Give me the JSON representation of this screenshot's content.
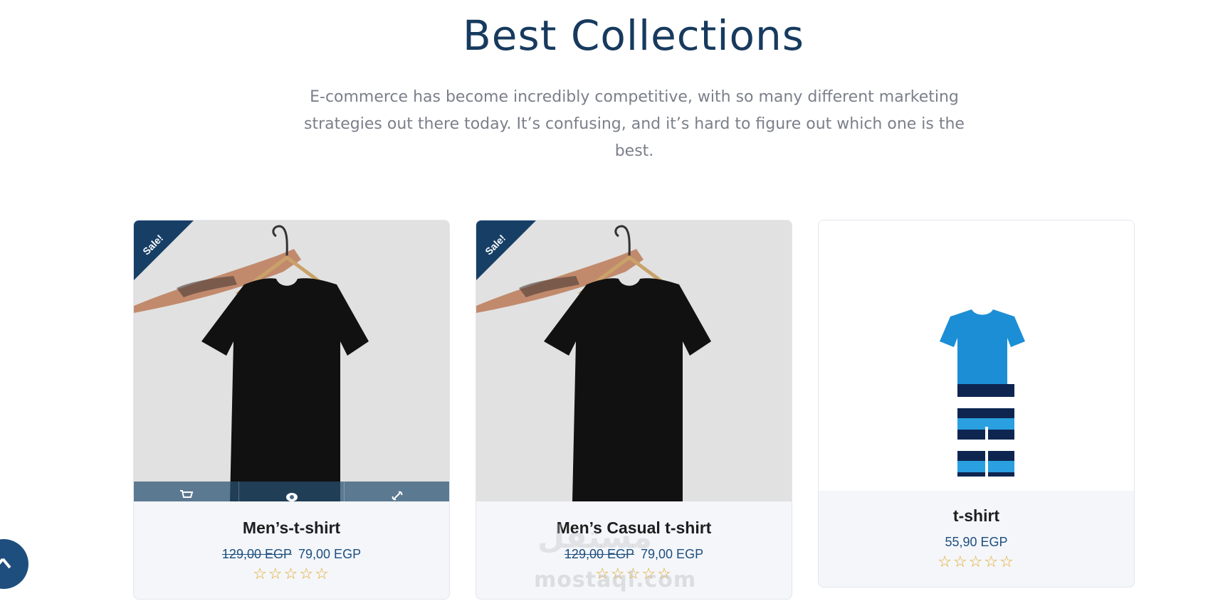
{
  "section": {
    "title": "Best Collections",
    "description": "E-commerce has become incredibly competitive, with so many different marketing strategies out there today. It’s confusing, and it’s hard to figure out which one is the best."
  },
  "products": [
    {
      "name": "Men’s-t-shirt",
      "old_price": "129,00 EGP",
      "price": "79,00 EGP",
      "badge": "Sale!",
      "rating": 0,
      "rating_stars": "☆☆☆☆☆",
      "actions": [
        "cart-icon",
        "eye-icon",
        "link-icon"
      ]
    },
    {
      "name": "Men’s Casual t-shirt",
      "old_price": "129,00 EGP",
      "price": "79,00 EGP",
      "badge": "Sale!",
      "rating": 0,
      "rating_stars": "☆☆☆☆☆"
    },
    {
      "name": "t-shirt",
      "price": "55,90 EGP",
      "rating": 0,
      "rating_stars": "☆☆☆☆☆"
    }
  ],
  "watermark": {
    "arabic": "مستقل",
    "latin": "mostaql.com"
  },
  "colors": {
    "title": "#173a5e",
    "price": "#1d4f7f",
    "badge": "#173f66",
    "star": "#e2a927",
    "card_bg": "#f4f6fa",
    "scroll_button": "#1e4e7e"
  }
}
